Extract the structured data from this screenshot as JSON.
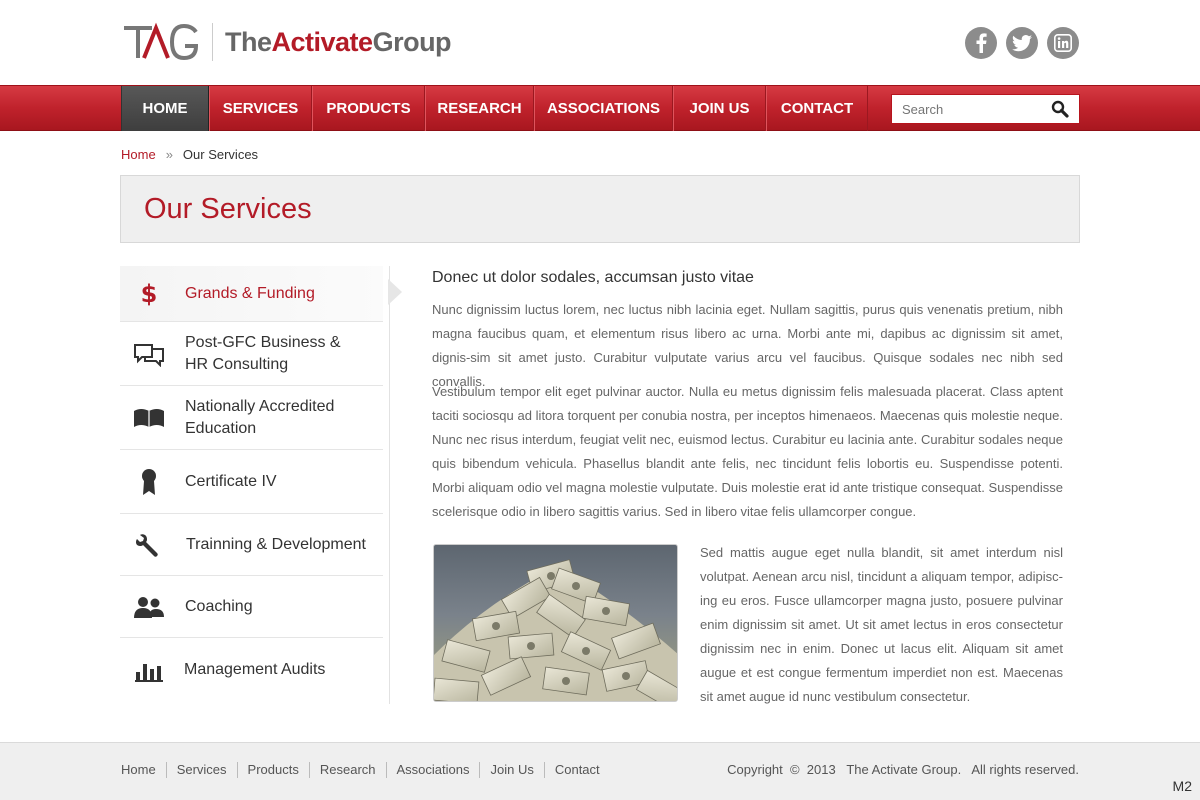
{
  "header": {
    "logo_mark": "TAG",
    "logo_text_prefix": "The",
    "logo_text_accent": "Activate",
    "logo_text_suffix": "Group",
    "social": [
      {
        "icon": "facebook-icon",
        "glyph": "f"
      },
      {
        "icon": "twitter-icon",
        "glyph": "t"
      },
      {
        "icon": "linkedin-icon",
        "glyph": "in"
      }
    ]
  },
  "nav": {
    "items": [
      "HOME",
      "SERVICES",
      "PRODUCTS",
      "RESEARCH",
      "ASSOCIATIONS",
      "JOIN US",
      "CONTACT"
    ],
    "active": "HOME",
    "search_placeholder": "Search"
  },
  "breadcrumb": {
    "home": "Home",
    "separator": "»",
    "current": "Our Services"
  },
  "page_title": "Our Services",
  "sidebar": {
    "items": [
      {
        "label": "Grands & Funding",
        "icon": "dollar-icon",
        "active": true
      },
      {
        "label": "Post-GFC Business & HR Consulting",
        "line1": "Post-GFC Business &",
        "line2": "HR Consulting",
        "icon": "chat-bubbles-icon"
      },
      {
        "label": "Nationally Accredited Education",
        "line1": "Nationally Accredited",
        "line2": "Education",
        "icon": "open-book-icon"
      },
      {
        "label": "Certificate IV",
        "icon": "award-ribbon-icon"
      },
      {
        "label": "Trainning & Development",
        "icon": "wrench-icon"
      },
      {
        "label": "Coaching",
        "icon": "users-icon"
      },
      {
        "label": "Management Audits",
        "icon": "bar-chart-icon"
      }
    ]
  },
  "content": {
    "heading": "Donec ut dolor sodales, accumsan justo vitae",
    "paragraph1": "Nunc dignissim luctus lorem, nec luctus nibh lacinia eget. Nullam sagittis, purus quis venenatis pretium, nibh magna faucibus quam, et elementum risus libero ac urna. Morbi ante mi, dapibus ac dignissim sit amet, dignis-sim sit amet justo. Curabitur vulputate varius arcu vel faucibus. Quisque sodales nec nibh sed convallis.",
    "paragraph2": "Vestibulum tempor elit eget pulvinar auctor. Nulla eu metus dignissim felis malesuada placerat. Class aptent taciti sociosqu ad litora torquent per conubia nostra, per inceptos himenaeos. Maecenas quis molestie neque. Nunc nec risus interdum, feugiat velit nec, euismod lectus. Curabitur eu lacinia ante. Curabitur sodales neque quis bibendum vehicula. Phasellus blandit ante felis, nec tincidunt felis lobortis eu. Suspendisse potenti. Morbi aliquam odio vel magna molestie vulputate. Duis molestie erat id ante tristique consequat. Suspendisse scelerisque odio in libero sagittis varius. Sed in libero vitae felis ullamcorper congue.",
    "paragraph3": "Sed mattis augue eget nulla blandit, sit amet interdum nisl volutpat. Aenean arcu nisl, tincidunt a aliquam tempor, adipisc-ing eu eros. Fusce ullamcorper magna justo, posuere pulvinar enim dignissim sit amet.  Ut sit amet lectus in eros consectetur dignissim nec in enim. Donec ut lacus elit. Aliquam sit amet augue et est congue fermentum imperdiet non est. Maecenas sit amet augue id nunc vestibulum consectetur.",
    "image_subject": "pile-of-dollar-bills-image"
  },
  "footer": {
    "links": [
      "Home",
      "Services",
      "Products",
      "Research",
      "Associations",
      "Join Us",
      "Contact"
    ],
    "copyright": "Copyright  ©  2013   The Activate Group.   All rights reserved."
  },
  "corner_tag": "M2",
  "colors": {
    "brand_red": "#b31b27",
    "nav_red": "#c0222c",
    "nav_active": "#4a4a4a",
    "social_gray": "#8c8c8c"
  }
}
